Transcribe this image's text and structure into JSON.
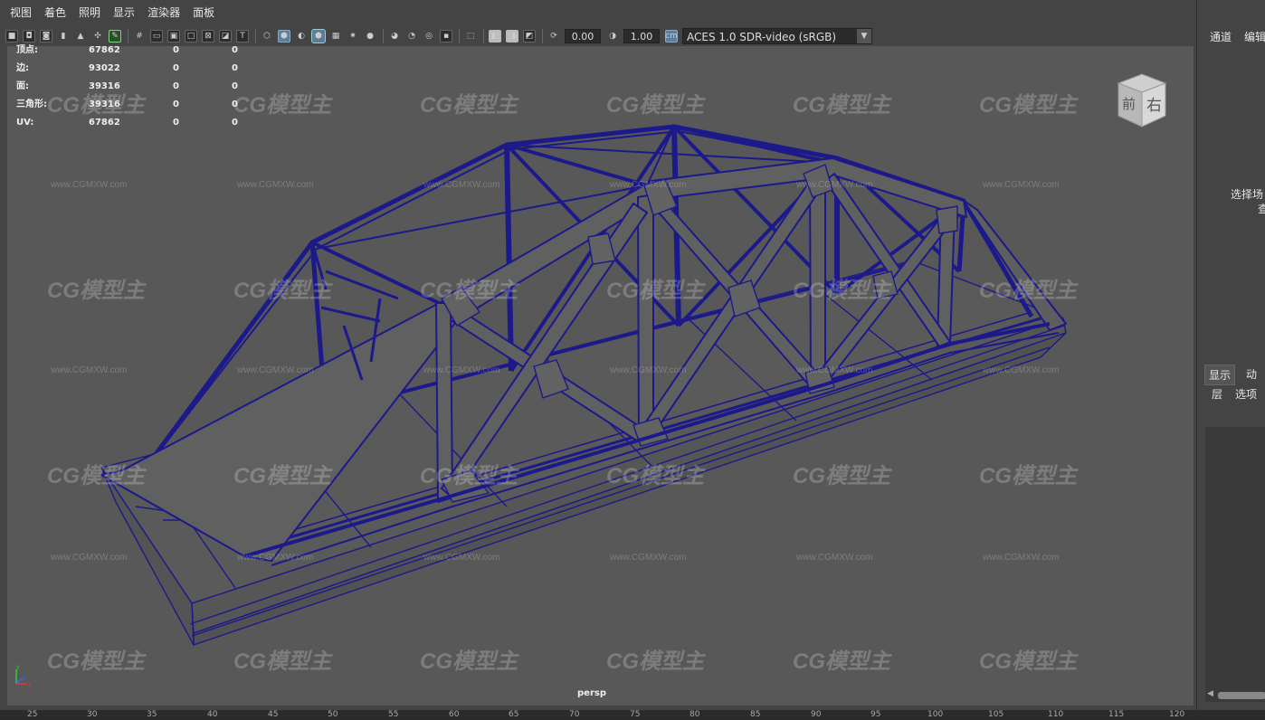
{
  "menu": {
    "items": [
      "视图",
      "着色",
      "照明",
      "显示",
      "渲染器",
      "面板"
    ]
  },
  "toolbar": {
    "gamma_value": "0.00",
    "exposure_value": "1.00",
    "color_management": "ACES 1.0 SDR-video (sRGB)",
    "icons": [
      "camera-select-icon",
      "camera-lock-icon",
      "camera-attributes-icon",
      "bookmark-icon",
      "image-plane-icon",
      "2d-pan-zoom-icon",
      "grease-pencil-icon",
      "grid-icon",
      "film-gate-icon",
      "resolution-gate-icon",
      "gate-mask-icon",
      "field-chart-icon",
      "safe-action-icon",
      "safe-title-icon",
      "wireframe-icon",
      "smooth-shade-icon",
      "default-material-icon",
      "wireframe-on-shaded-icon",
      "xray-icon",
      "use-all-lights-icon",
      "shadows-icon",
      "screen-space-ao-icon",
      "motion-blur-icon",
      "multisample-aa-icon",
      "depth-of-field-icon",
      "isolate-select-icon",
      "xray-joints-icon",
      "xray-active-icon",
      "backface-icon",
      "gamma-icon",
      "exposure-icon",
      "color-management-icon"
    ]
  },
  "hud": {
    "rows": [
      {
        "label": "顶点:",
        "v1": "67862",
        "v2": "0",
        "v3": "0"
      },
      {
        "label": "边:",
        "v1": "93022",
        "v2": "0",
        "v3": "0"
      },
      {
        "label": "面:",
        "v1": "39316",
        "v2": "0",
        "v3": "0"
      },
      {
        "label": "三角形:",
        "v1": "39316",
        "v2": "0",
        "v3": "0"
      },
      {
        "label": "UV:",
        "v1": "67862",
        "v2": "0",
        "v3": "0"
      }
    ]
  },
  "viewport": {
    "camera_label": "persp",
    "viewcube_front": "前",
    "viewcube_right": "右",
    "watermark_text": "CG模型主",
    "watermark_url": "www.CGMXW.com"
  },
  "right_panel": {
    "tab_channels": "通道",
    "tab_edit": "编辑",
    "hint_line1": "选择场",
    "hint_line2": "查",
    "tab_display": "显示",
    "tab_anim": "动",
    "layers_menu": "层",
    "options_menu": "选项"
  },
  "timeline": {
    "ticks": [
      "25",
      "30",
      "35",
      "40",
      "45",
      "50",
      "55",
      "60",
      "65",
      "70",
      "75",
      "80",
      "85",
      "90",
      "95",
      "100",
      "105",
      "110",
      "115",
      "120"
    ]
  },
  "colors": {
    "wire": "#1c1a8a",
    "viewport_bg": "#585858",
    "panel_bg": "#444444"
  }
}
